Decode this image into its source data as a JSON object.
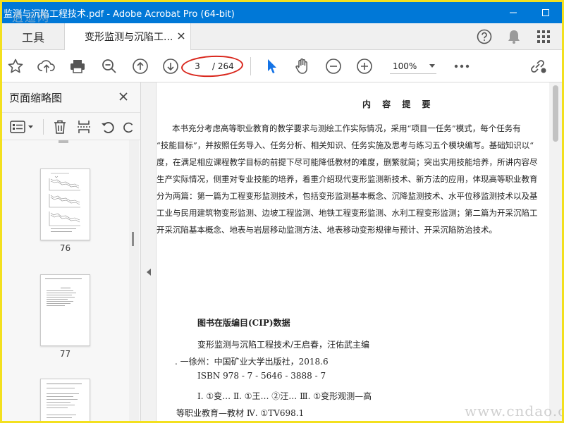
{
  "window": {
    "title": "监测与沉陷工程技术.pdf - Adobe Acrobat Pro (64-bit)",
    "watermark_top": "逍遥网"
  },
  "tabs": {
    "tools_label": "工具",
    "doc_tab_label": "变形监测与沉陷工..."
  },
  "toolbar": {
    "page_current": "3",
    "page_total": "/ 264",
    "zoom": "100%",
    "accent_color": "#1473e6",
    "highlight_color": "#d9261c"
  },
  "thumbnail_pane": {
    "title": "页面缩略图",
    "thumbnails": [
      {
        "page": "76"
      },
      {
        "page": "77"
      }
    ]
  },
  "document": {
    "heading": "内 容 提 要",
    "body_lines": [
      "本书充分考虑高等职业教育的教学要求与测绘工作实际情况，采用“项目一任务”模式，每个任务有",
      "“技能目标”，并按照任务导入、任务分析、相关知识、任务实施及思考与练习五个模块编写。基础知识以“",
      "度，在满足相应课程教学目标的前提下尽可能降低教材的难度，删繁就简；突出实用技能培养，所讲内容尽",
      "生产实际情况，侧重对专业技能的培养，着重介绍现代变形监测新技术、新方法的应用，体现高等职业教育",
      "分为两篇：第一篇为工程变形监测技术，包括变形监测基本概念、沉降监测技术、水平位移监测技术以及基",
      "工业与民用建筑物变形监测、边坡工程监测、地铁工程变形监测、水利工程变形监测；第二篇为开采沉陷工",
      "开采沉陷基本概念、地表与岩层移动监测方法、地表移动变形规律与预计、开采沉陷防治技术。"
    ],
    "cip_title": "图书在版编目(CIP)数据",
    "cip_lines": [
      "变形监测与沉陷工程技术/王启春，汪佑武主编",
      ". 一徐州：中国矿业大学出版社，2018.6",
      "ISBN 978 - 7 - 5646 - 3888 - 7",
      "Ⅰ. ①变… Ⅱ. ①王… ②汪… Ⅲ. ①变形观测—高",
      "等职业教育—教材 Ⅳ. ①TV698.1"
    ],
    "watermark_bottom": "www.cndao.com"
  }
}
